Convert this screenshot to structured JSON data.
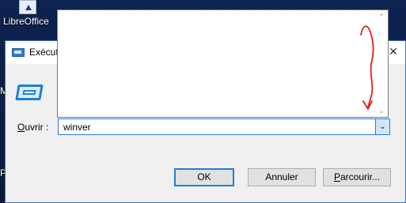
{
  "desktop": {
    "icon_label": "LibreOffice",
    "edge_letters": [
      "M",
      "P"
    ]
  },
  "dialog": {
    "title": "Exécut",
    "close_glyph": "✕",
    "open_label_prefix": "O",
    "open_label_rest": "uvrir :",
    "command_value": "winver",
    "dropdown_arrow": "⌄",
    "buttons": {
      "ok": "OK",
      "cancel": "Annuler",
      "browse_prefix": "P",
      "browse_rest": "arcourir..."
    }
  },
  "popup": {
    "scroll_up": "⌃",
    "scroll_down": "⌄",
    "annotation_color": "#e0201c"
  }
}
